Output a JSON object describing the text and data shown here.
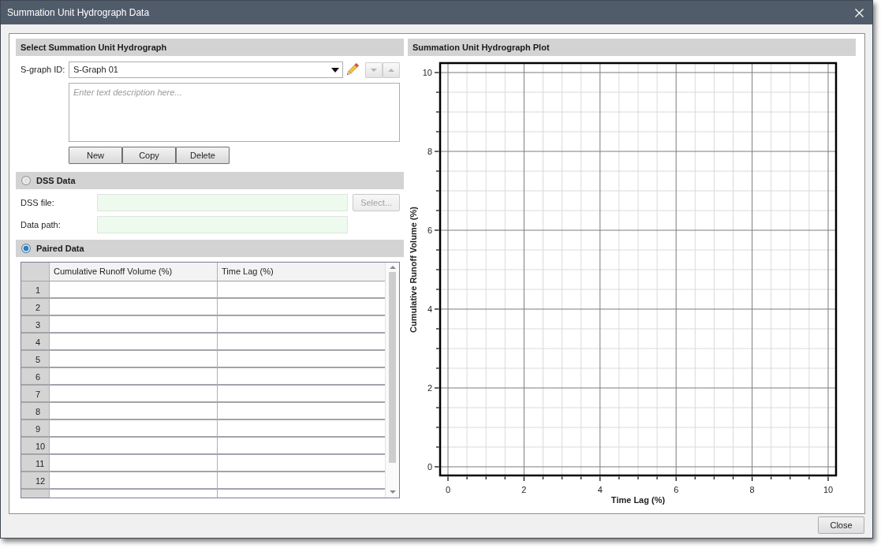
{
  "window": {
    "title": "Summation Unit Hydrograph Data"
  },
  "select_section": {
    "title": "Select Summation Unit Hydrograph",
    "sgraph_label": "S-graph ID:",
    "sgraph_value": "S-Graph 01",
    "description": {
      "placeholder": "Enter text description here..."
    },
    "move_buttons": [
      {
        "kind": "down",
        "disabled": true
      },
      {
        "kind": "up",
        "disabled": true
      }
    ],
    "buttons": [
      "New",
      "Copy",
      "Delete"
    ]
  },
  "dss_section": {
    "title": "DSS Data",
    "selected": false,
    "fields": [
      {
        "label": "DSS file:"
      },
      {
        "label": "Data path:"
      }
    ],
    "select_button": {
      "label": "Select...",
      "disabled": true
    }
  },
  "paired_section": {
    "title": "Paired Data",
    "selected": true,
    "table": {
      "columns": [
        "Cumulative Runoff Volume (%)",
        "Time Lag (%)"
      ],
      "row_numbers": [
        "1",
        "2",
        "3",
        "4",
        "5",
        "6",
        "7",
        "8",
        "9",
        "10",
        "11",
        "12"
      ]
    }
  },
  "plot": {
    "title": "Summation Unit Hydrograph Plot",
    "chart_data": {
      "type": "line",
      "xlabel": "Time Lag (%)",
      "ylabel": "Cumulative Runoff Volume (%)",
      "xlim": [
        0,
        10
      ],
      "ylim": [
        0,
        10
      ],
      "xticks": [
        0,
        2,
        4,
        6,
        8,
        10
      ],
      "yticks": [
        0,
        2,
        4,
        6,
        8,
        10
      ],
      "grid": true
    }
  },
  "footer": {
    "buttons": [
      "Close"
    ]
  }
}
